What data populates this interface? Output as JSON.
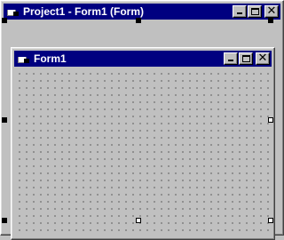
{
  "outer_window": {
    "title": "Project1 - Form1 (Form)",
    "icon": "form-designer-icon",
    "buttons": [
      "minimize",
      "maximize",
      "close"
    ]
  },
  "form": {
    "title": "Form1",
    "icon": "form-icon",
    "buttons": [
      "minimize",
      "maximize",
      "close"
    ]
  },
  "glyphs": {
    "close": "✕"
  },
  "colors": {
    "titlebar": "#000080",
    "face": "#c0c0c0",
    "grid_dot": "#000000"
  }
}
